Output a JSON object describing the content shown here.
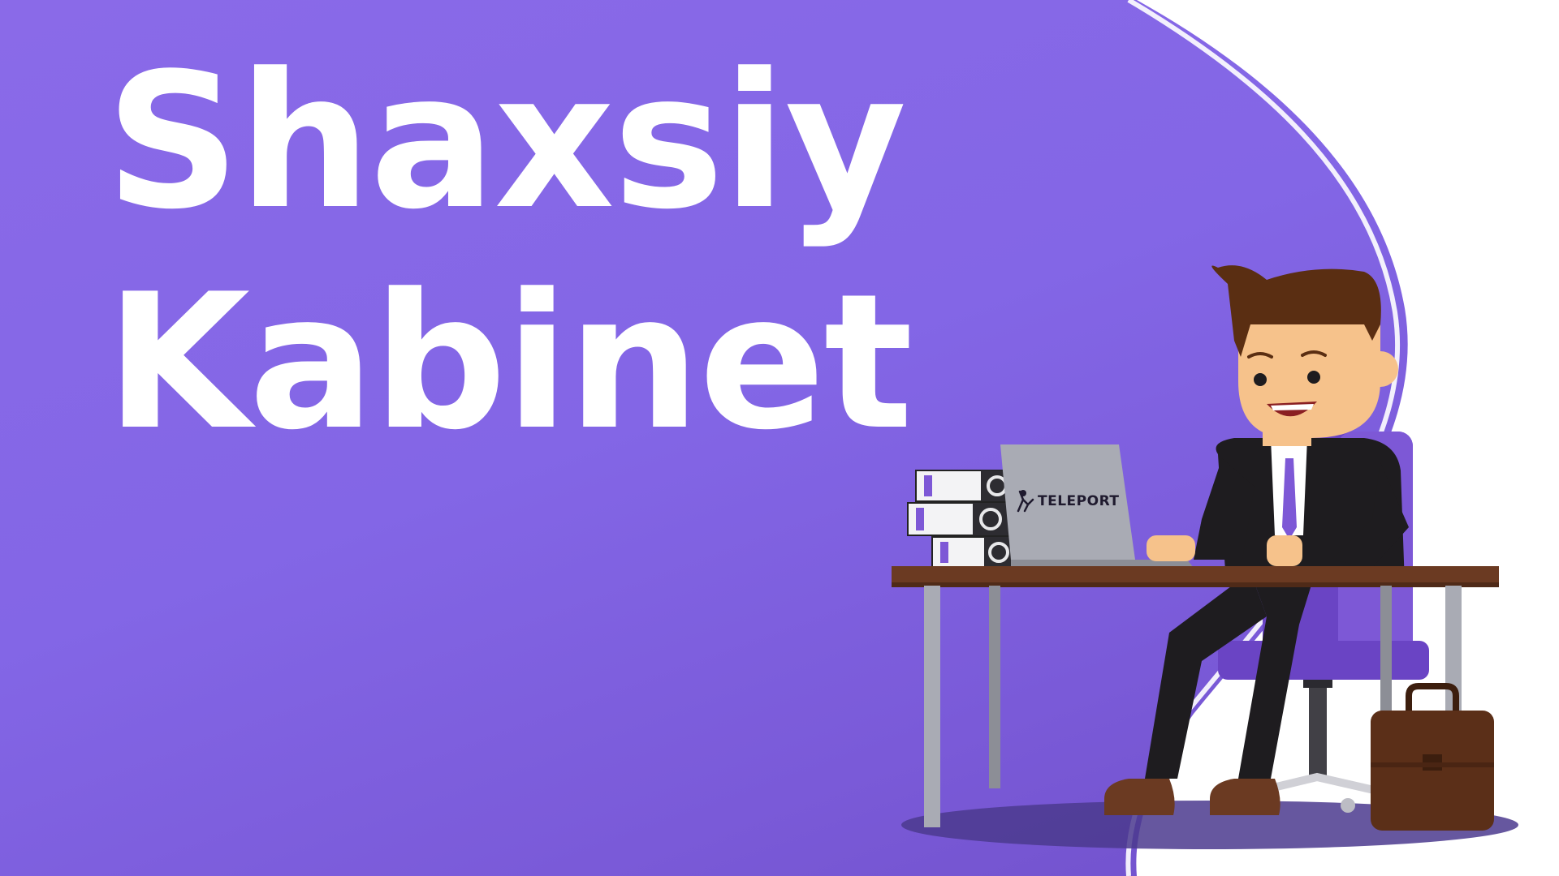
{
  "headline": {
    "line1": "Shaxsiy",
    "line2": "Kabinet"
  },
  "laptop": {
    "brand": "TELEPORT"
  },
  "colors": {
    "background": "#8366e6",
    "background_dark": "#6f4fc8",
    "wave": "#ffffff",
    "chair": "#6a44c4",
    "suit": "#1e1c1f",
    "skin": "#f6c28b",
    "hair": "#5a2e12",
    "desk": "#6b3a22",
    "briefcase": "#5b2f18"
  },
  "icons": {
    "laptop_logo": "teleport-runner-icon",
    "binders": "binder-stack-icon",
    "briefcase": "briefcase-icon"
  }
}
